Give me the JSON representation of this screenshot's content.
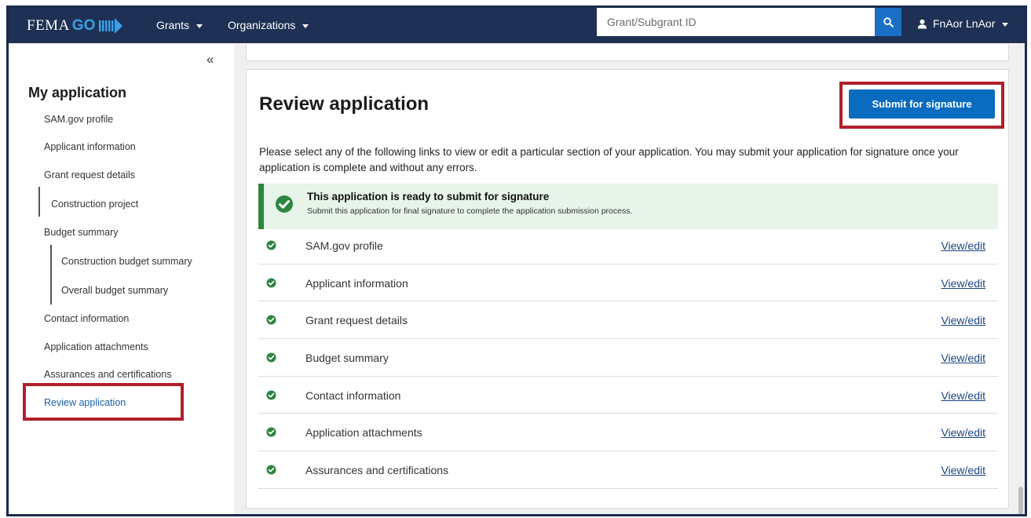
{
  "header": {
    "brand_fema": "FEMA",
    "brand_go": "GO",
    "nav": [
      {
        "label": "Grants"
      },
      {
        "label": "Organizations"
      }
    ],
    "search_placeholder": "Grant/Subgrant ID",
    "user_name": "FnAor LnAor",
    "colors": {
      "bar": "#1e3154",
      "accent": "#1a6fc4"
    }
  },
  "sidebar": {
    "collapse_glyph": "«",
    "title": "My application",
    "items": [
      {
        "label": "SAM.gov profile"
      },
      {
        "label": "Applicant information"
      },
      {
        "label": "Grant request details"
      },
      {
        "label": "Construction project"
      },
      {
        "label": "Budget summary"
      },
      {
        "label": "Construction budget summary"
      },
      {
        "label": "Overall budget summary"
      },
      {
        "label": "Contact information"
      },
      {
        "label": "Application attachments"
      },
      {
        "label": "Assurances and certifications"
      },
      {
        "label": "Review application",
        "active": true
      }
    ]
  },
  "main": {
    "title": "Review application",
    "submit_label": "Submit for signature",
    "intro": "Please select any of the following links to view or edit a particular section of your application. You may submit your application for signature once your application is complete and without any errors.",
    "alert": {
      "title": "This application is ready to submit for signature",
      "subtitle": "Submit this application for final signature to complete the application submission process.",
      "color": "#2e8540"
    },
    "sections": [
      {
        "label": "SAM.gov profile",
        "link": "View/edit",
        "status": "complete"
      },
      {
        "label": "Applicant information",
        "link": "View/edit",
        "status": "complete"
      },
      {
        "label": "Grant request details",
        "link": "View/edit",
        "status": "complete"
      },
      {
        "label": "Budget summary",
        "link": "View/edit",
        "status": "complete"
      },
      {
        "label": "Contact information",
        "link": "View/edit",
        "status": "complete"
      },
      {
        "label": "Application attachments",
        "link": "View/edit",
        "status": "complete"
      },
      {
        "label": "Assurances and certifications",
        "link": "View/edit",
        "status": "complete"
      }
    ]
  },
  "highlight_color": "#b11f2c"
}
